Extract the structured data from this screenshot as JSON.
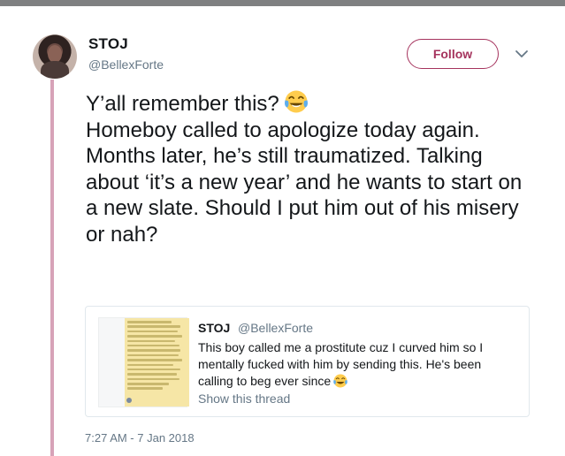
{
  "author": {
    "name": "STOJ",
    "handle": "@BellexForte"
  },
  "follow_button": {
    "label": "Follow"
  },
  "tweet": {
    "text": "Y’all remember this?",
    "text_continued": "Homeboy called to apologize today again. Months later, he’s still traumatized. Talking about ‘it’s a new year’ and he wants to start on a new slate. Should I put him out of his misery or nah?",
    "emoji": "face-with-tears-of-joy-icon",
    "timestamp": "7:27 AM - 7 Jan 2018"
  },
  "quoted_tweet": {
    "name": "STOJ",
    "handle": "@BellexForte",
    "text": "This boy called me a prostitute cuz I curved him so I mentally fucked with him by sending this. He's been calling to beg ever since",
    "emoji": "face-with-tears-of-joy-icon",
    "show_thread": "Show this thread",
    "thumbnail": "handwritten-note-image"
  },
  "colors": {
    "accent": "#a5335d",
    "thread_line": "#d7a3b8",
    "secondary_text": "#657786",
    "top_bar": "#7f8081"
  }
}
